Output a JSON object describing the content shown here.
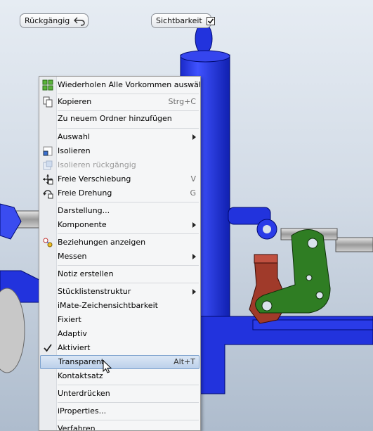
{
  "toolbar": {
    "undo_label": "Rückgängig",
    "visibility_label": "Sichtbarkeit",
    "visibility_checked": true
  },
  "menu": {
    "items": [
      {
        "label": "Wiederholen Alle Vorkommen auswählen",
        "icon": "grid-select-icon"
      },
      {
        "label": "Kopieren",
        "shortcut": "Strg+C",
        "icon": "copy-icon"
      },
      {
        "label": "Zu neuem Ordner hinzufügen"
      },
      {
        "label": "Auswahl",
        "submenu": true
      },
      {
        "label": "Isolieren",
        "icon": "isolate-icon"
      },
      {
        "label": "Isolieren rückgängig",
        "icon": "undo-isolate-icon",
        "disabled": true
      },
      {
        "label": "Freie Verschiebung",
        "shortcut": "V",
        "icon": "free-move-icon"
      },
      {
        "label": "Freie Drehung",
        "shortcut": "G",
        "icon": "free-rotate-icon"
      },
      {
        "label": "Darstellung..."
      },
      {
        "label": "Komponente",
        "submenu": true
      },
      {
        "label": "Beziehungen anzeigen",
        "icon": "relationships-icon"
      },
      {
        "label": "Messen",
        "submenu": true
      },
      {
        "label": "Notiz erstellen"
      },
      {
        "label": "Stücklistenstruktur",
        "submenu": true
      },
      {
        "label": "iMate-Zeichensichtbarkeit"
      },
      {
        "label": "Fixiert"
      },
      {
        "label": "Adaptiv"
      },
      {
        "label": "Aktiviert",
        "checked": true
      },
      {
        "label": "Transparent",
        "shortcut": "Alt+T",
        "highlighted": true
      },
      {
        "label": "Kontaktsatz"
      },
      {
        "label": "Unterdrücken"
      },
      {
        "label": "iProperties..."
      },
      {
        "label": "Verfahren"
      }
    ]
  },
  "colors": {
    "part_blue": "#2233dd",
    "part_red": "#a03a2a",
    "part_green": "#2f7d23",
    "highlight": "#c6d8ee"
  }
}
